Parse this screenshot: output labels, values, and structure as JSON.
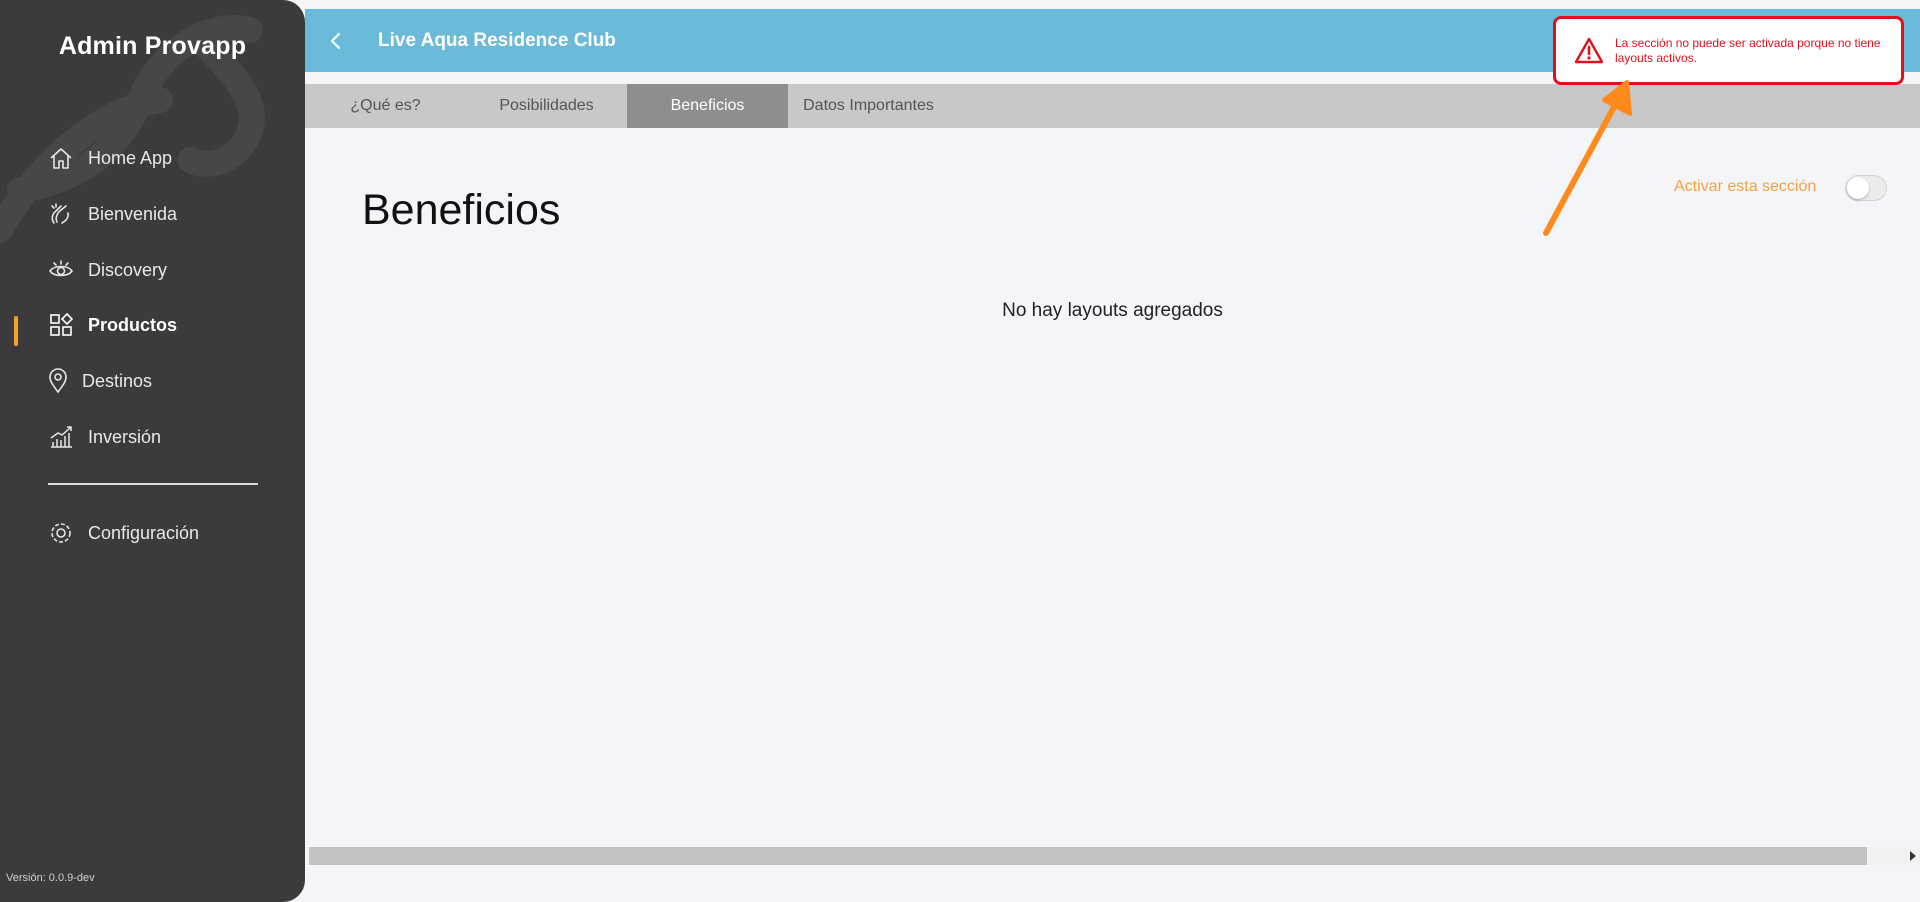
{
  "sidebar": {
    "title": "Admin Provapp",
    "items": [
      {
        "label": "Home App",
        "icon": "home-icon"
      },
      {
        "label": "Bienvenida",
        "icon": "clapping-hands-icon"
      },
      {
        "label": "Discovery",
        "icon": "eye-icon"
      },
      {
        "label": "Productos",
        "icon": "grid-diamond-icon",
        "active": true
      },
      {
        "label": "Destinos",
        "icon": "location-pin-icon"
      },
      {
        "label": "Inversión",
        "icon": "growth-chart-icon"
      }
    ],
    "settings": {
      "label": "Configuración",
      "icon": "gear-icon"
    },
    "version": "Versión: 0.0.9-dev"
  },
  "header": {
    "title": "Live Aqua Residence Club"
  },
  "tabs": [
    {
      "label": "¿Qué es?"
    },
    {
      "label": "Posibilidades"
    },
    {
      "label": "Beneficios",
      "active": true
    },
    {
      "label": "Datos Importantes"
    }
  ],
  "main": {
    "title": "Beneficios",
    "toggle_label": "Activar esta sección",
    "toggle_on": false,
    "empty_message": "No hay layouts agregados"
  },
  "alert": {
    "message": "La sección no puede ser activada porque no tiene layouts activos."
  },
  "colors": {
    "sidebar_bg": "#3b3b3b",
    "header_bg": "#6abad9",
    "accent": "#f5a12a",
    "alert_red": "#e0111c",
    "annotation_arrow": "#ff8a1c"
  }
}
